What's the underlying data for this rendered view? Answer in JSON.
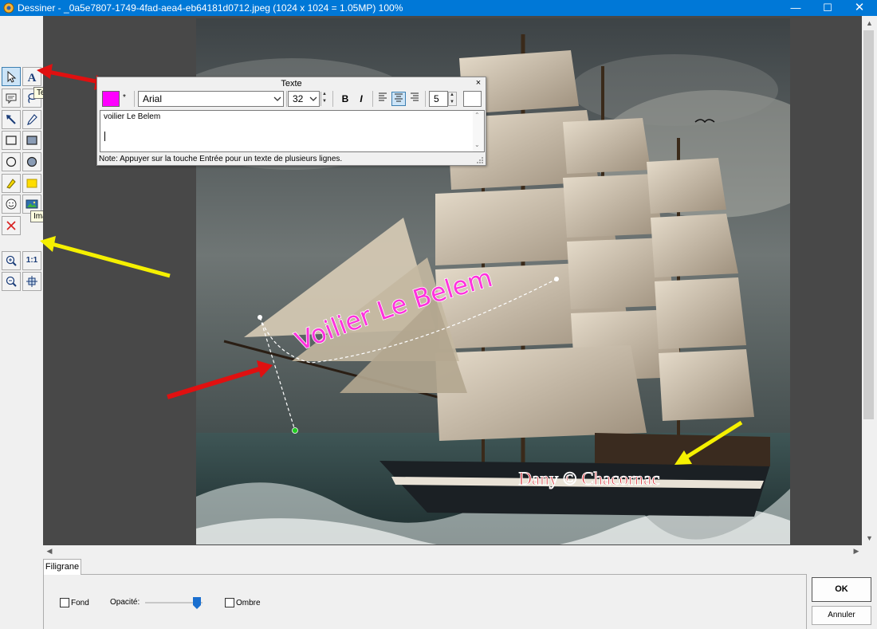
{
  "window": {
    "title": "Dessiner  -  _0a5e7807-1749-4fad-aea4-eb64181d0712.jpeg  (1024 x 1024 = 1.05MP)    100%",
    "minimize_glyph": "—",
    "maximize_glyph": "☐",
    "close_glyph": "✕"
  },
  "toolbar": {
    "zoom_reset_label": "1:1"
  },
  "tooltips": {
    "text_tool": "Texte",
    "watermark_tool": "Image du filigrane"
  },
  "text_dialog": {
    "title": "Texte",
    "close_glyph": "×",
    "color": "#ff00ff",
    "color_star": "*",
    "font_family": "Arial",
    "font_size": "32",
    "bold_label": "B",
    "italic_label": "I",
    "outline_width": "5",
    "content": "voilier Le Belem",
    "note": "Note: Appuyer sur la touche Entrée pour un texte de plusieurs lignes."
  },
  "canvas": {
    "overlay_text": "Voilier Le Belem",
    "overlay_text_color": "#ff33dd",
    "watermark_text": "Dany © Chacornac",
    "watermark_color": "#d4232b"
  },
  "bottom_panel": {
    "tab_label": "Filigrane",
    "background_checkbox": "Fond",
    "opacity_label": "Opacité:",
    "opacity_value": 0.9,
    "shadow_checkbox": "Ombre",
    "ok_label": "OK",
    "cancel_label": "Annuler"
  }
}
